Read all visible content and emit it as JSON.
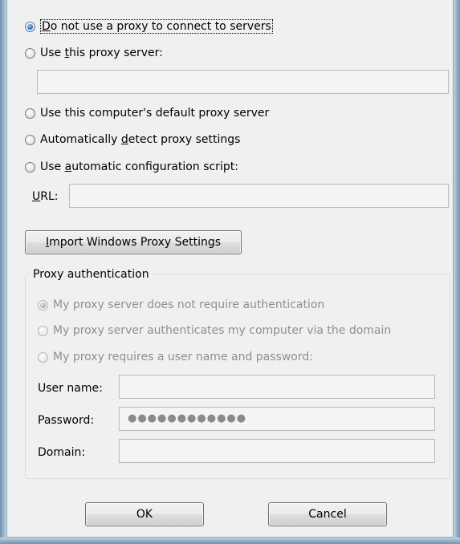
{
  "proxy_options": {
    "no_proxy": {
      "prefix": "",
      "accel": "D",
      "rest": "o not use a proxy to connect to servers",
      "checked": true
    },
    "use_this_proxy": {
      "prefix": "Use ",
      "accel": "t",
      "rest": "his proxy server:",
      "checked": false
    },
    "proxy_server_value": "",
    "default_proxy": {
      "label": "Use this computer's default proxy server",
      "checked": false
    },
    "auto_detect": {
      "prefix": "Automatically ",
      "accel": "d",
      "rest": "etect proxy settings",
      "checked": false
    },
    "auto_config": {
      "prefix": "Use ",
      "accel": "a",
      "rest": "utomatic configuration script:",
      "checked": false
    },
    "url_label": {
      "accel": "U",
      "rest": "RL:"
    },
    "url_value": ""
  },
  "import_button": {
    "accel": "I",
    "rest": "mport Windows Proxy Settings"
  },
  "proxy_auth": {
    "title": "Proxy authentication",
    "options": [
      {
        "label": "My proxy server does not require authentication",
        "checked": true
      },
      {
        "label": "My proxy server authenticates my computer via the domain",
        "checked": false
      },
      {
        "label": "My proxy requires a user name and password:",
        "checked": false
      }
    ],
    "user_name_label": "User name:",
    "user_name_value": "",
    "password_label": "Password:",
    "password_value": "●●●●●●●●●●●●",
    "domain_label": "Domain:",
    "domain_value": ""
  },
  "buttons": {
    "ok": "OK",
    "cancel": "Cancel"
  }
}
